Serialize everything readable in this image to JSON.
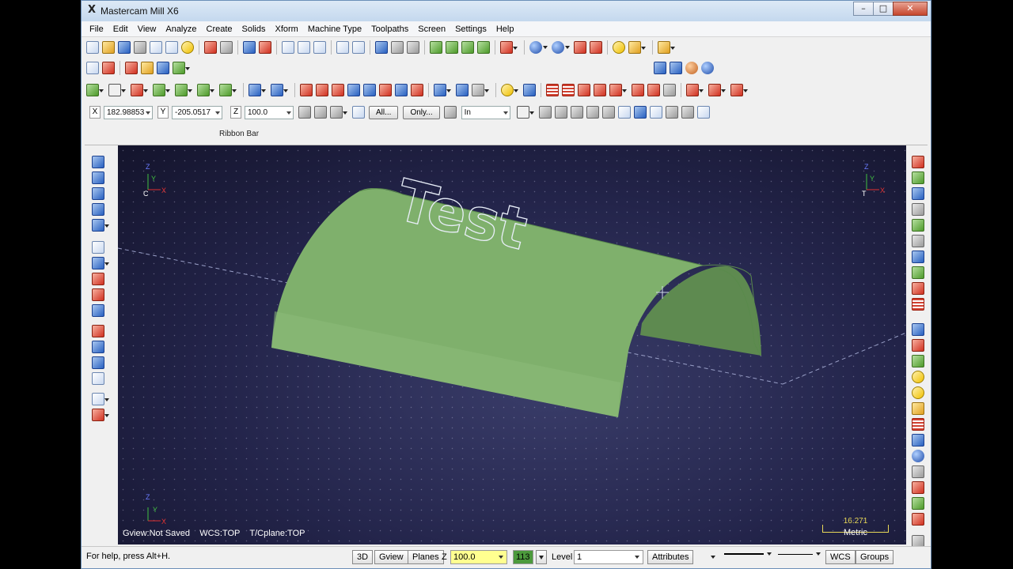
{
  "window": {
    "title": "Mastercam Mill X6",
    "app_icon": "X",
    "min_glyph": "–",
    "max_glyph": "□",
    "close_glyph": "✕"
  },
  "menu": [
    "File",
    "Edit",
    "View",
    "Analyze",
    "Create",
    "Solids",
    "Xform",
    "Machine Type",
    "Toolpaths",
    "Screen",
    "Settings",
    "Help"
  ],
  "coords": {
    "x_label": "X",
    "x_value": "182.98853",
    "y_label": "Y",
    "y_value": "-205.0517",
    "z_label": "Z",
    "z_value": "100.0",
    "all_button": "All...",
    "only_button": "Only...",
    "units_value": "In"
  },
  "ribbon": {
    "label": "Ribbon Bar"
  },
  "viewport": {
    "text_on_surface": "Test",
    "gview": "Gview:Not Saved",
    "wcs": "WCS:TOP",
    "tcplane": "T/Cplane:TOP",
    "scale_value": "16.271",
    "scale_unit": "Metric",
    "surface_color": "#7fb06c",
    "triad_left_c": "C",
    "triad_right_t": "T",
    "triad_x": "X",
    "triad_y": "Y",
    "triad_z": "Z"
  },
  "status": {
    "help": "For help, press Alt+H.",
    "btn_3d": "3D",
    "btn_gview": "Gview",
    "btn_planes": "Planes",
    "z_label": "Z",
    "z_value": "100.0",
    "color_value": "113",
    "level_label": "Level",
    "level_value": "1",
    "btn_attributes": "Attributes",
    "btn_wcs": "WCS",
    "btn_groups": "Groups"
  },
  "colors": {
    "title_bg": "#c4d8ee",
    "viewport_bg": "#23244a",
    "surface": "#7fb06c",
    "z_field_bg": "#ffff90",
    "color_swatch": "#4c9a3c"
  }
}
